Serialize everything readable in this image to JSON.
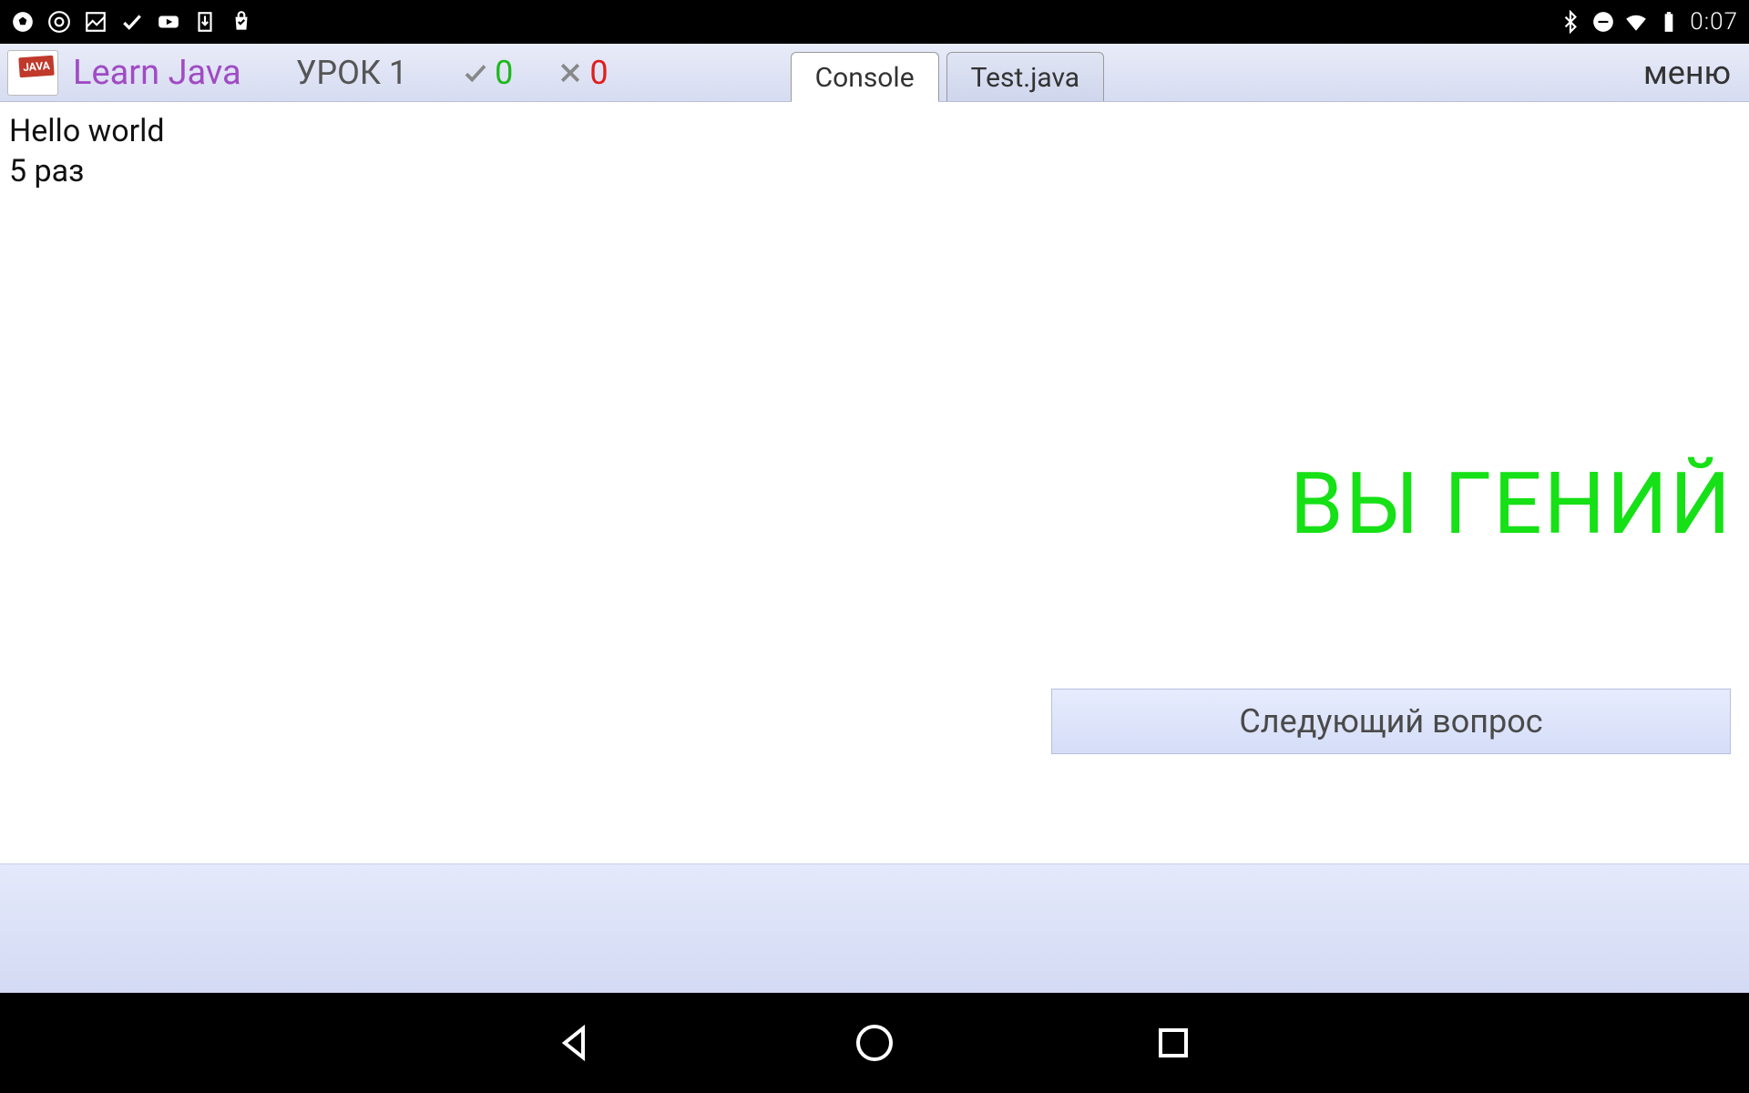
{
  "statusBar": {
    "time": "0:07"
  },
  "header": {
    "appTitle": "Learn Java",
    "lesson": "УРОК 1",
    "correctCount": "0",
    "wrongCount": "0",
    "tabs": [
      {
        "label": "Console",
        "active": true
      },
      {
        "label": "Test.java",
        "active": false
      }
    ],
    "menu": "меню",
    "logoText": "JAVA"
  },
  "console": {
    "output": "Hello world\n5 раз"
  },
  "result": {
    "genius": "ВЫ ГЕНИЙ",
    "nextButton": "Следующий вопрос"
  }
}
